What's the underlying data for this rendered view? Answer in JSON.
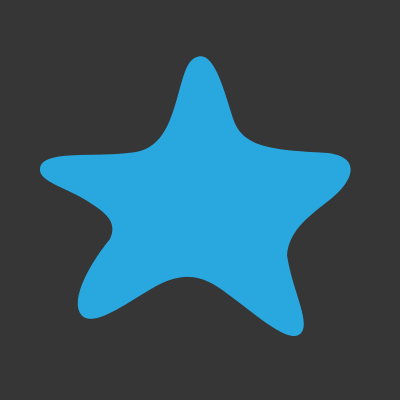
{
  "colors": {
    "background": "#363636",
    "star_fill": "#29A8E0"
  },
  "graphic": {
    "icon": "star-icon",
    "shape": "rounded five-point star"
  }
}
